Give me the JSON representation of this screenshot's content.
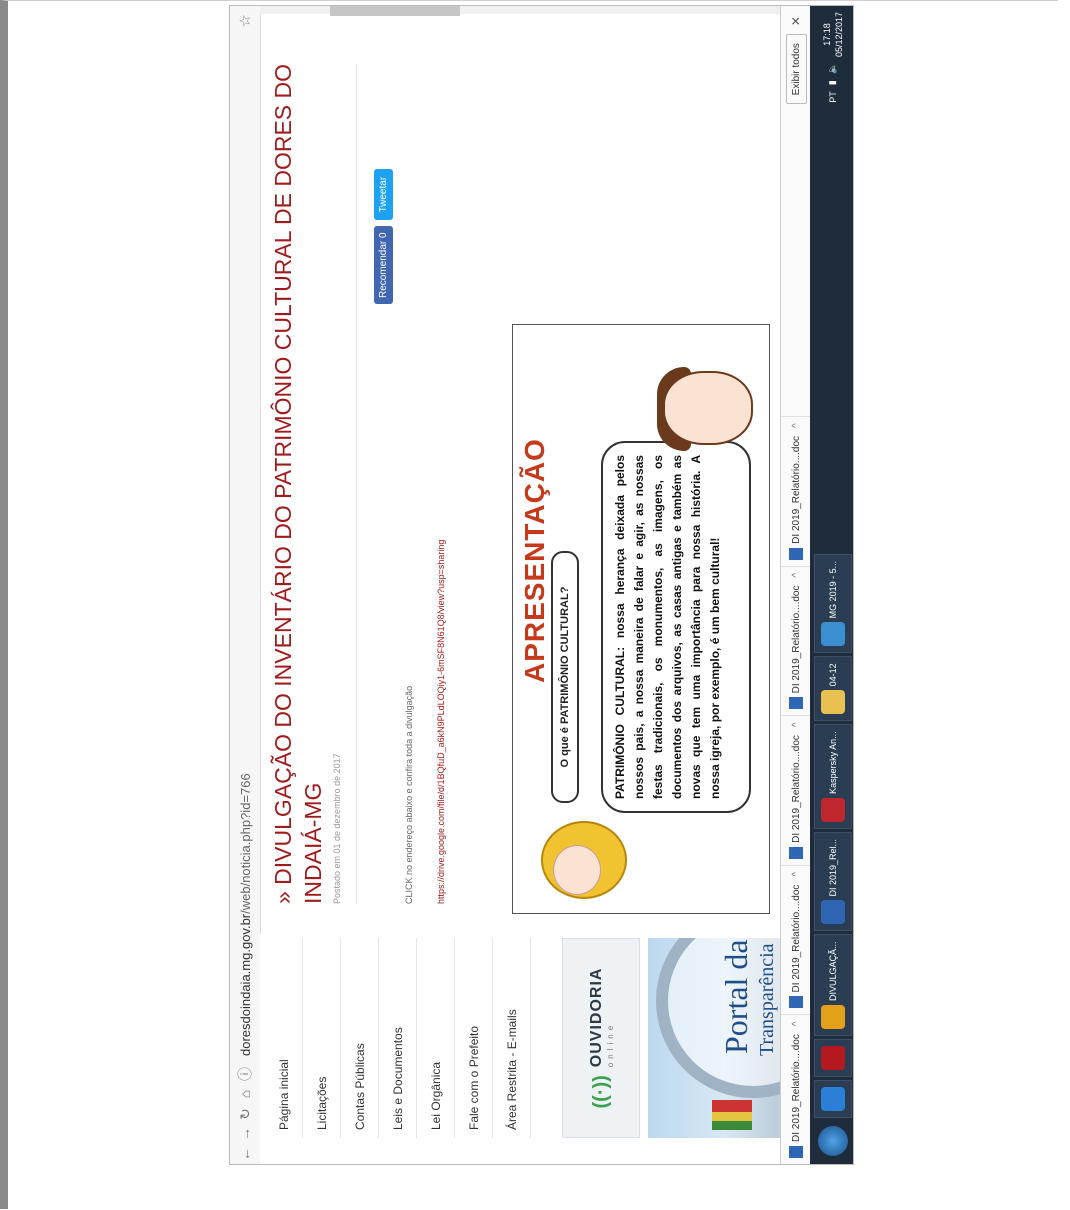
{
  "browser": {
    "url_prefix": "doresdoindaia.mg.gov.br",
    "url_path": "/web/noticia.php?id=766"
  },
  "sidebar": {
    "items": [
      {
        "label": "Página inicial"
      },
      {
        "label": "Licitações"
      },
      {
        "label": "Contas Públicas"
      },
      {
        "label": "Leis e Documentos"
      },
      {
        "label": "Lei Orgânica"
      },
      {
        "label": "Fale com o Prefeito"
      },
      {
        "label": "Área Restrita - E-mails"
      }
    ],
    "ouvidoria": {
      "title": "OUVIDORIA",
      "subtitle": "online"
    },
    "portal": {
      "line1": "Portal da",
      "line2": "Transparência"
    }
  },
  "article": {
    "title": "» DIVULGAÇÃO DO INVENTÁRIO DO PATRIMÔNIO CULTURAL DE DORES DO INDAIÁ-MG",
    "posted": "Postado em 01 de dezembro de 2017",
    "facebook_label": "Recomendar 0",
    "twitter_label": "Tweetar",
    "click_text": "CLICK no endereço abaixo e confira toda a divulgação",
    "link": "https://drive.google.com/file/d/1BQfuD_a6kN9PLdLOQiy1-6mSF8N61Q8/view?usp=sharing"
  },
  "panel": {
    "heading": "APRESENTAÇÃO",
    "question": "O que é PATRIMÔNIO CULTURAL?",
    "answer": "PATRIMÔNIO CULTURAL: nossa herança deixada pelos nossos pais, a nossa maneira de falar e agir, as nossas festas tradicionais, os monumentos, as imagens, os documentos dos arquivos, as casas antigas e também as novas que tem uma importância para nossa história. A nossa igreja, por exemplo, é um bem cultural!"
  },
  "downloads": [
    {
      "label": "DI 2019_Relatório....doc"
    },
    {
      "label": "DI 2019_Relatório....doc"
    },
    {
      "label": "DI 2019_Relatório....doc"
    },
    {
      "label": "DI 2019_Relatório....doc"
    },
    {
      "label": "DI 2019_Relatório....doc"
    }
  ],
  "downloads_show_all": "Exibir todos",
  "taskbar": {
    "buttons": [
      {
        "label": "DIVULGAÇÃ...",
        "color": "#e3a21a"
      },
      {
        "label": "DI 2019_Rel...",
        "color": "#2f66b3"
      },
      {
        "label": "Kaspersky An...",
        "color": "#c0262d"
      },
      {
        "label": "04-12",
        "color": "#e8c150"
      },
      {
        "label": "MG 2019 - 5...",
        "color": "#3b8fd1"
      }
    ],
    "language": "PT",
    "time": "17:18",
    "date": "05/12/2017"
  }
}
